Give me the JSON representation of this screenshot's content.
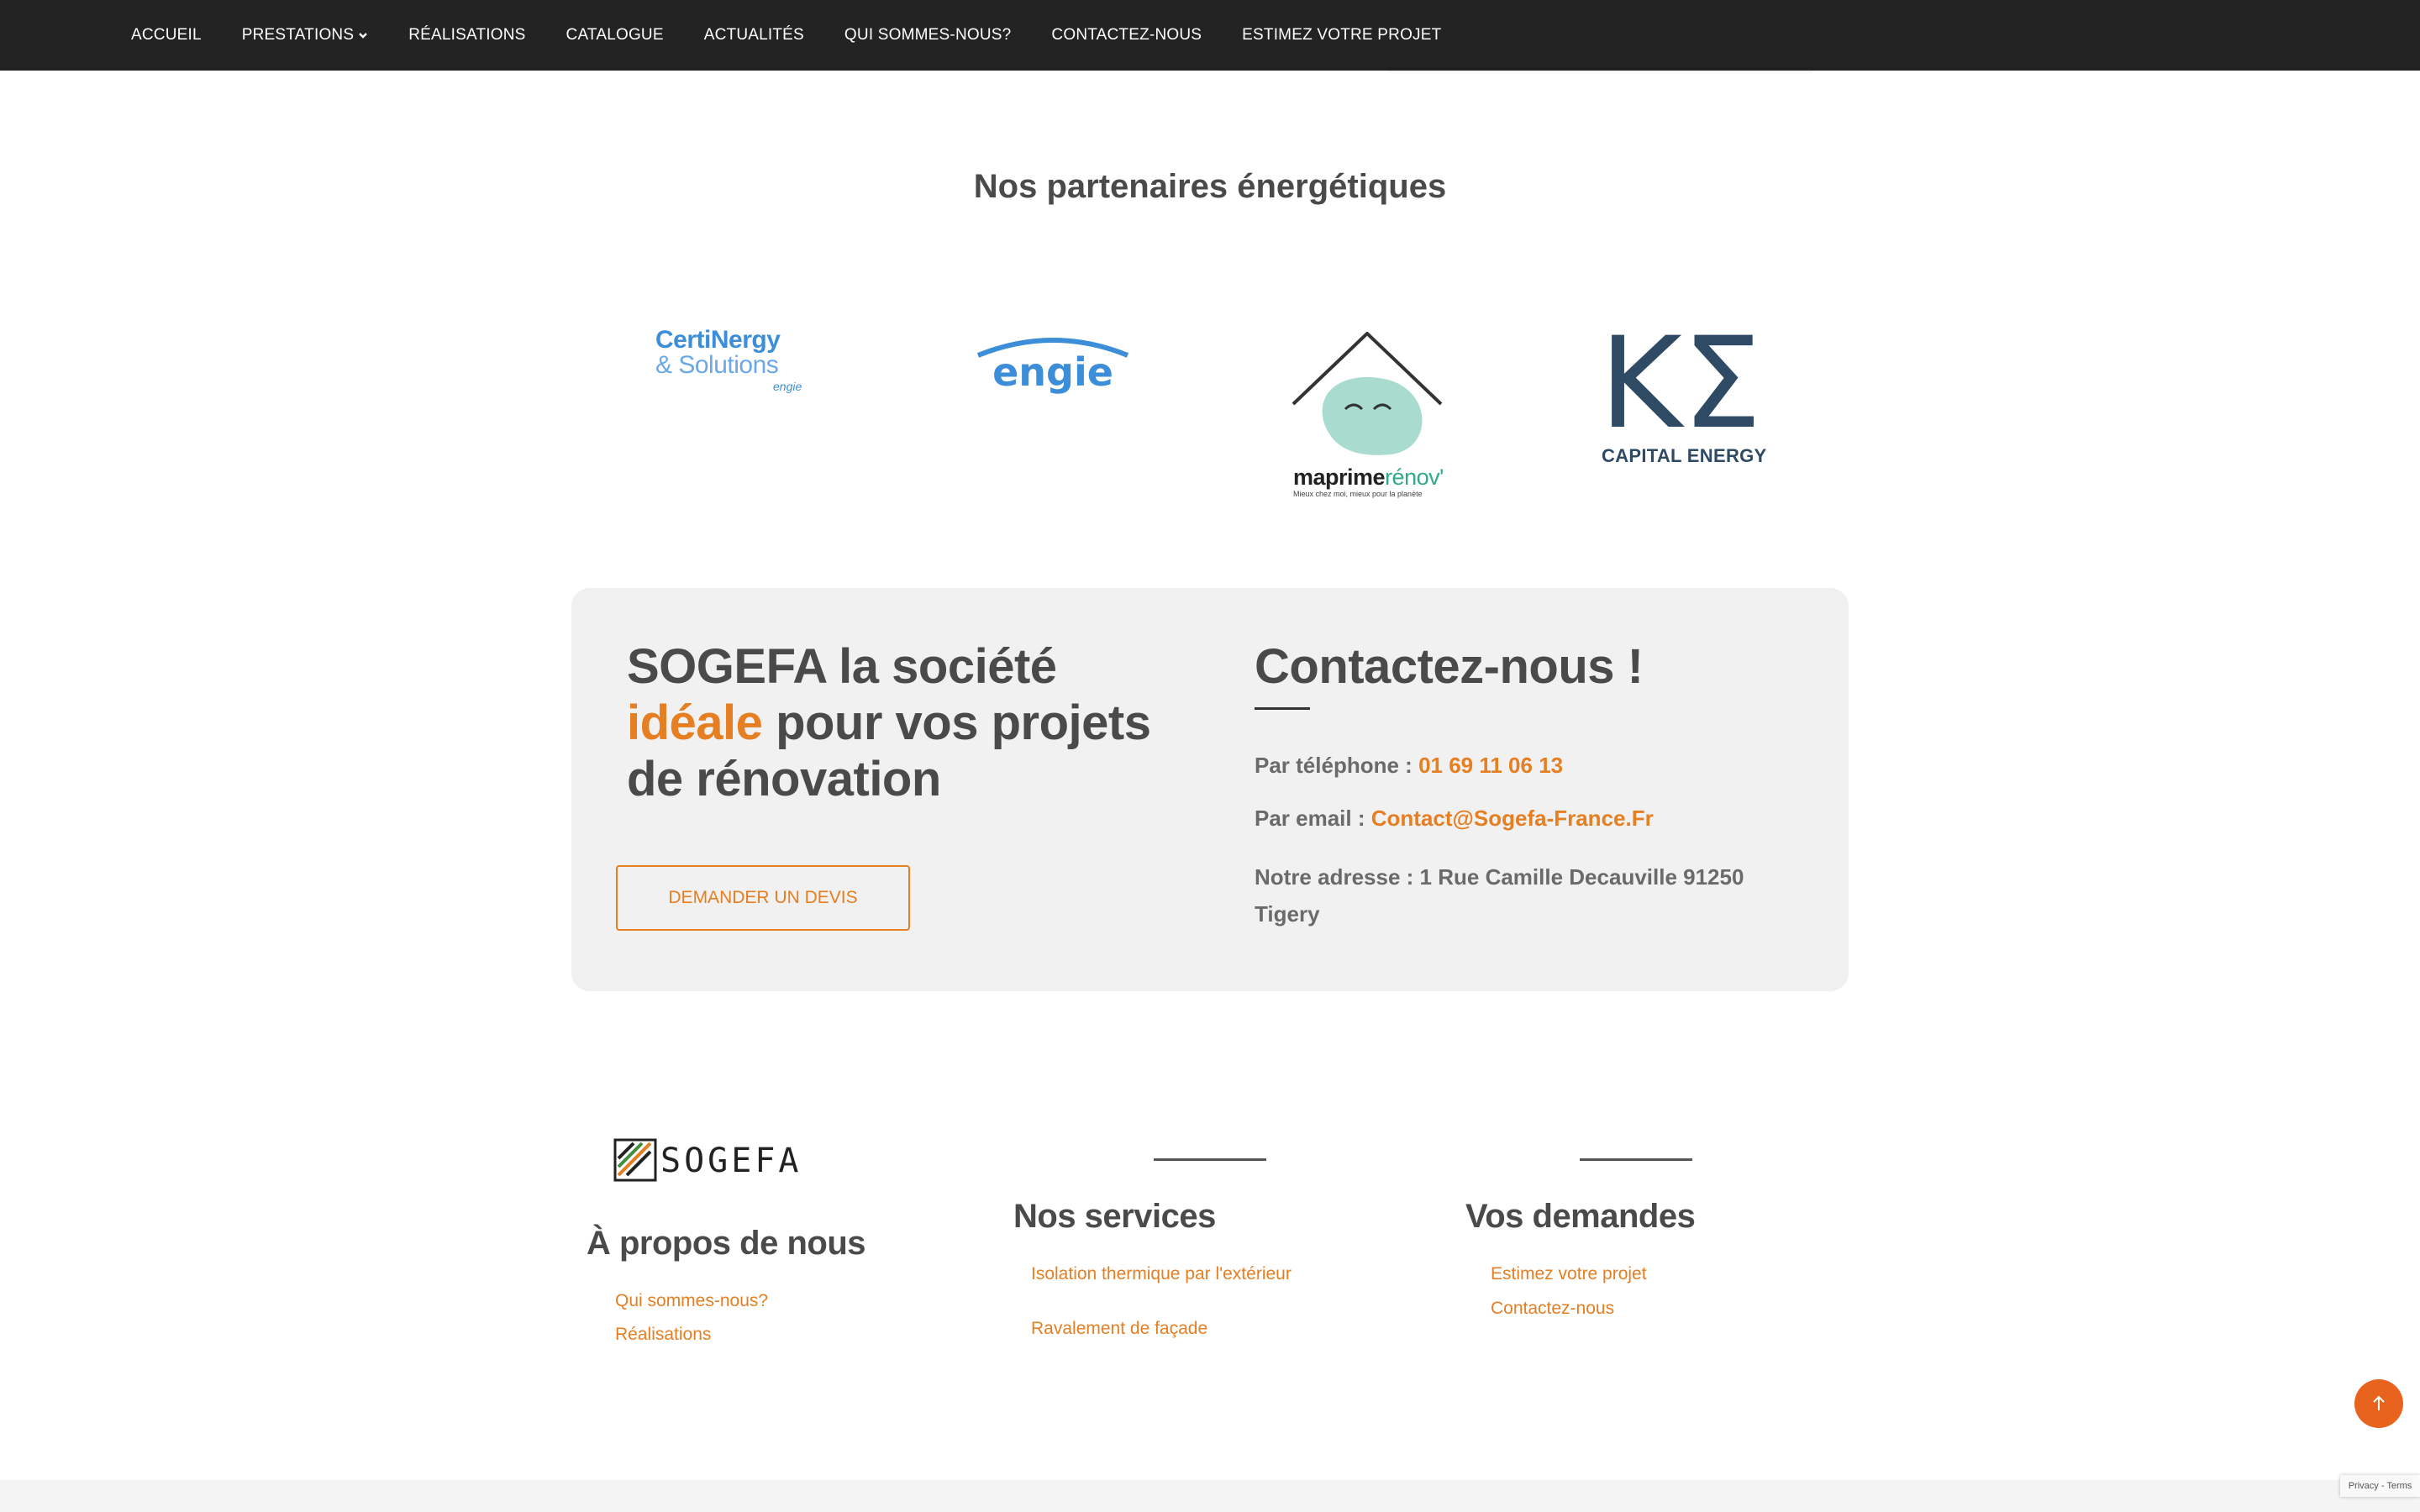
{
  "nav": {
    "items": [
      {
        "label": "ACCUEIL"
      },
      {
        "label": "PRESTATIONS",
        "has_dropdown": true
      },
      {
        "label": "RÉALISATIONS"
      },
      {
        "label": "CATALOGUE"
      },
      {
        "label": "ACTUALITÉS"
      },
      {
        "label": "QUI SOMMES-NOUS?"
      },
      {
        "label": "CONTACTEZ-NOUS"
      },
      {
        "label": "ESTIMEZ VOTRE PROJET"
      }
    ]
  },
  "partners": {
    "title": "Nos partenaires énergétiques",
    "logos": {
      "certinergy": {
        "line1": "CertiNergy",
        "line2": "& Solutions",
        "sub": "engie"
      },
      "engie": {
        "text": "engie"
      },
      "maprimerenov": {
        "bold": "maprime",
        "accent": "rénov'",
        "tagline": "Mieux chez moi, mieux pour la planète"
      },
      "capital_energy": {
        "symbol": "ΚΣ",
        "caption": "CAPITAL ENERGY"
      }
    }
  },
  "cta": {
    "heading_part1": "SOGEFA la société",
    "heading_accent": "idéale",
    "heading_part2": "pour vos projets de rénovation",
    "button_label": "DEMANDER UN DEVIS"
  },
  "contact": {
    "title": "Contactez-nous !",
    "phone_label": "Par téléphone :",
    "phone_value": "01 69 11 06 13",
    "email_label": "Par email :",
    "email_value": "Contact@Sogefa-France.Fr",
    "address_label": "Notre adresse :",
    "address_value": "1 Rue Camille Decauville 91250 Tigery"
  },
  "footer": {
    "brand": "SOGEFA",
    "about": {
      "title": "À propos de nous",
      "links": [
        "Qui sommes-nous?",
        "Réalisations"
      ]
    },
    "services": {
      "title": "Nos services",
      "links": [
        "Isolation thermique par l'extérieur",
        "Ravalement de façade"
      ]
    },
    "requests": {
      "title": "Vos demandes",
      "links": [
        "Estimez votre projet",
        "Contactez-nous"
      ]
    }
  },
  "recaptcha_text": "Privacy - Terms",
  "colors": {
    "nav_bg": "#232323",
    "accent": "#e67e22",
    "box_bg": "#f1f1f1",
    "heading": "#4a4a4a"
  },
  "icons": [
    "chevron-down-icon",
    "arrow-up-icon",
    "sogefa-logo-mark"
  ]
}
